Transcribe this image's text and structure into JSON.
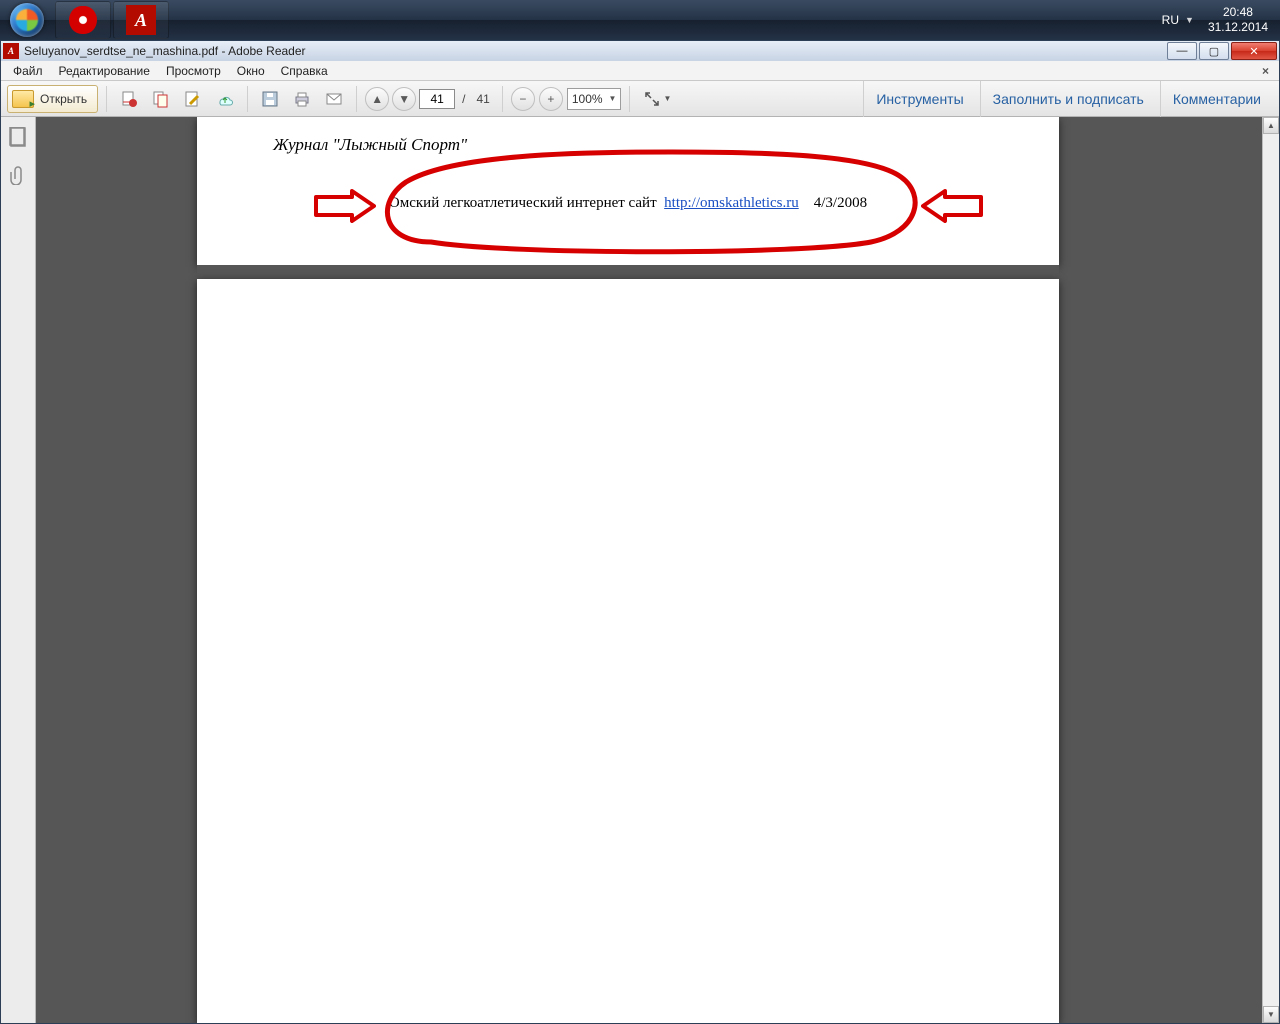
{
  "taskbar": {
    "lang": "RU",
    "time": "20:48",
    "date": "31.12.2014"
  },
  "window": {
    "title": "Seluyanov_serdtse_ne_mashina.pdf - Adobe Reader"
  },
  "menu": {
    "file": "Файл",
    "edit": "Редактирование",
    "view": "Просмотр",
    "window": "Окно",
    "help": "Справка"
  },
  "toolbar": {
    "open": "Открыть",
    "page_current": "41",
    "page_sep": "/",
    "page_total": "41",
    "zoom": "100%",
    "tools": "Инструменты",
    "sign": "Заполнить и подписать",
    "comments": "Комментарии"
  },
  "doc": {
    "journal": "Журнал \"Лыжный Спорт\"",
    "line2_text": "Омский легкоатлетический интернет сайт",
    "line2_url": "http://omskathletics.ru",
    "line2_date": "4/3/2008"
  }
}
